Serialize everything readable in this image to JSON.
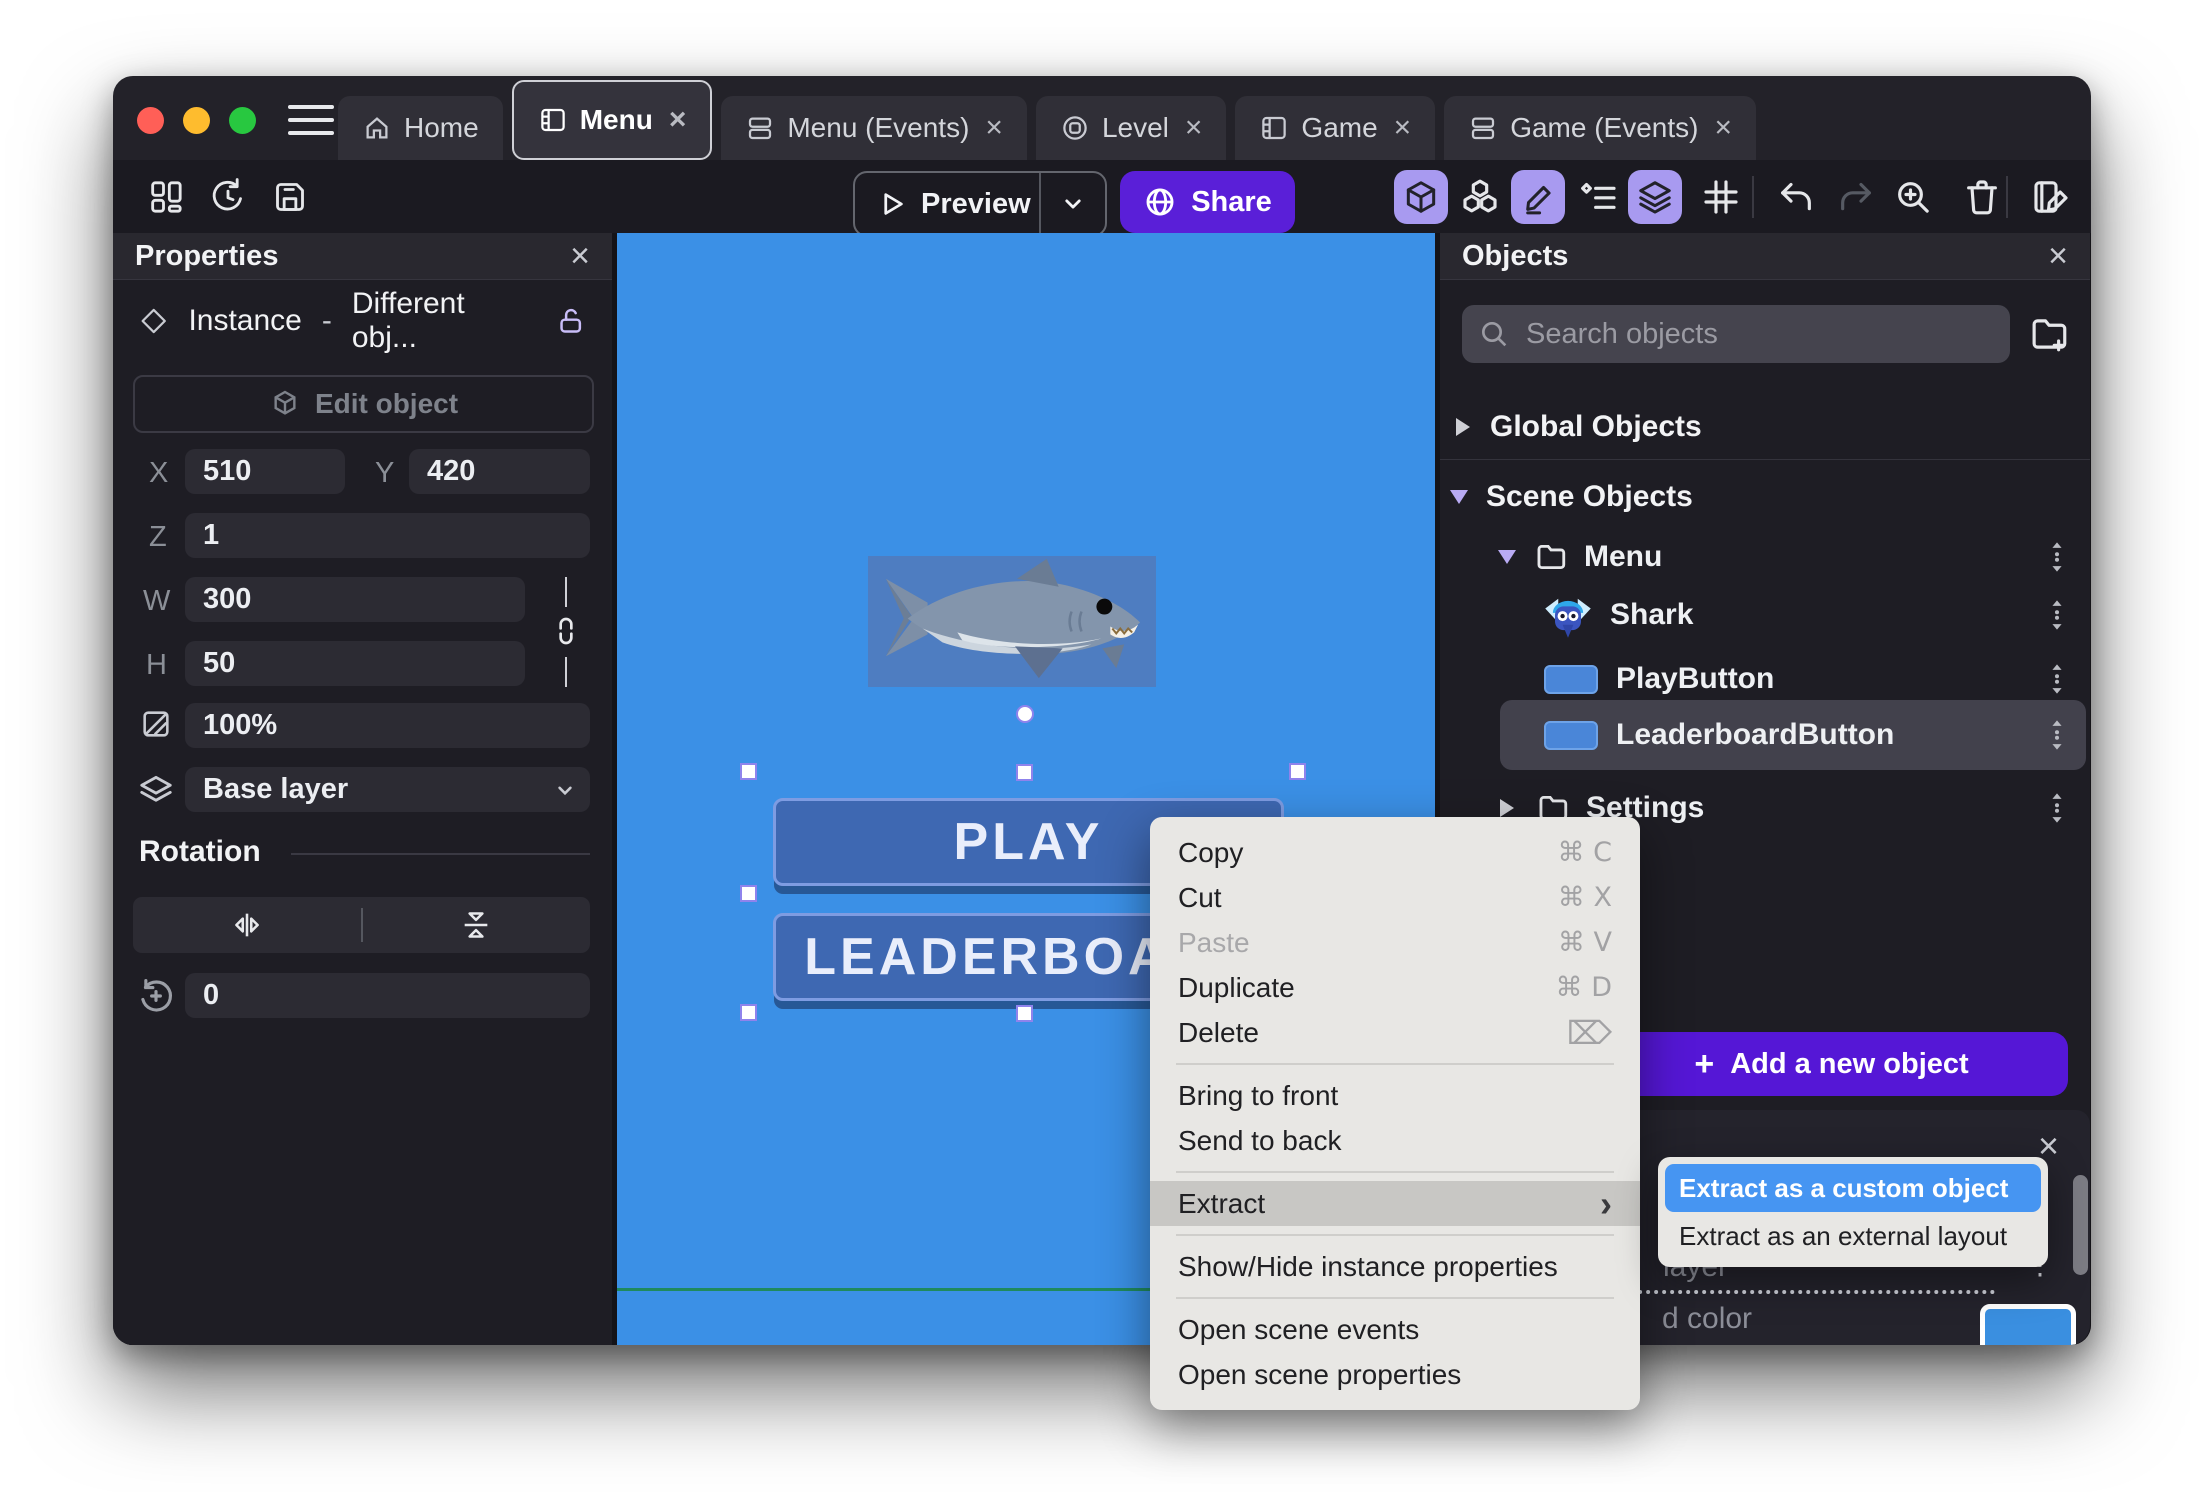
{
  "window": {
    "tabs": [
      {
        "label": "Home",
        "closable": false
      },
      {
        "label": "Menu",
        "closable": true,
        "active": true
      },
      {
        "label": "Menu (Events)",
        "closable": true
      },
      {
        "label": "Level",
        "closable": true
      },
      {
        "label": "Game",
        "closable": true
      },
      {
        "label": "Game (Events)",
        "closable": true
      }
    ],
    "close_glyph": "×"
  },
  "toolbar": {
    "preview_label": "Preview",
    "share_label": "Share"
  },
  "properties_panel": {
    "title": "Properties",
    "close_glyph": "×",
    "instance_type": "Instance",
    "separator": "-",
    "instance_value": "Different obj...",
    "edit_object_label": "Edit object",
    "x_label": "X",
    "x_value": "510",
    "y_label": "Y",
    "y_value": "420",
    "z_label": "Z",
    "z_value": "1",
    "w_label": "W",
    "w_value": "300",
    "h_label": "H",
    "h_value": "50",
    "opacity_value": "100%",
    "layer_value": "Base layer",
    "rotation_title": "Rotation",
    "rotation_value": "0"
  },
  "objects_panel": {
    "title": "Objects",
    "close_glyph": "×",
    "search_placeholder": "Search objects",
    "global_label": "Global Objects",
    "scene_label": "Scene Objects",
    "items": [
      {
        "label": "Menu",
        "kind": "folder-expanded"
      },
      {
        "label": "Shark",
        "kind": "object"
      },
      {
        "label": "PlayButton",
        "kind": "object"
      },
      {
        "label": "LeaderboardButton",
        "kind": "object",
        "selected": true
      },
      {
        "label": "Settings",
        "kind": "folder-collapsed"
      }
    ],
    "add_button_label": "Add a new object",
    "add_button_plus": "+"
  },
  "instance_panel": {
    "close_glyph": "×",
    "layer_fragment": "layer",
    "color_fragment": "d color",
    "swatch_color": "#3a8fe0"
  },
  "canvas": {
    "play_label": "PLAY",
    "leaderboard_label": "LEADERBOARD"
  },
  "context_menu": {
    "items": [
      {
        "label": "Copy",
        "shortcut": "⌘ C"
      },
      {
        "label": "Cut",
        "shortcut": "⌘ X"
      },
      {
        "label": "Paste",
        "shortcut": "⌘ V",
        "disabled": true
      },
      {
        "label": "Duplicate",
        "shortcut": "⌘ D"
      },
      {
        "label": "Delete",
        "shortcut": "⌦"
      },
      {
        "label": "Bring to front"
      },
      {
        "label": "Send to back"
      },
      {
        "label": "Extract",
        "highlighted": true,
        "submenu_arrow": "›"
      },
      {
        "label": "Show/Hide instance properties"
      },
      {
        "label": "Open scene events"
      },
      {
        "label": "Open scene properties"
      }
    ]
  },
  "submenu": {
    "items": [
      {
        "label": "Extract as a custom object",
        "selected": true
      },
      {
        "label": "Extract as an external layout"
      }
    ]
  },
  "colors": {
    "canvas_background": "#3b90e6",
    "scene_border_line": "#1f8a5e",
    "share_purple": "#5a1fd8",
    "add_button_purple": "#5517d6",
    "submenu_highlight_blue": "#4695f2",
    "toolbar_active_chip": "#a89af0",
    "selection_handle_outline": "#8f83ec",
    "traffic_red": "#ff5f57",
    "traffic_yellow": "#febc2e",
    "traffic_green": "#28c840"
  }
}
